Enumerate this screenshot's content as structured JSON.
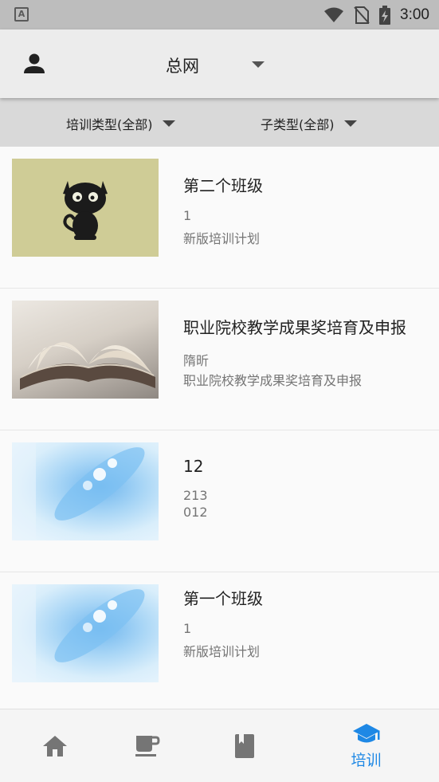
{
  "status_bar": {
    "time": "3:00",
    "notification_icon": "a-notification-icon",
    "icons": [
      "wifi-icon",
      "no-sim-icon",
      "battery-charging-icon"
    ]
  },
  "header": {
    "title": "总网",
    "user_icon": "user-icon",
    "dropdown_icon": "caret-down-icon"
  },
  "filters": [
    {
      "label": "培训类型(全部)"
    },
    {
      "label": "子类型(全部)"
    }
  ],
  "list": {
    "items": [
      {
        "title": "第二个班级",
        "line1": "1",
        "line2": "新版培训计划",
        "thumbnail": "cat-image"
      },
      {
        "title": "职业院校教学成果奖培育及申报",
        "line1": "隋昕",
        "line2": "职业院校教学成果奖培育及申报",
        "thumbnail": "book-image"
      },
      {
        "title": "12",
        "line1": "213",
        "line2": "012",
        "thumbnail": "blue-abstract-image"
      },
      {
        "title": "第一个班级",
        "line1": "1",
        "line2": "新版培训计划",
        "thumbnail": "blue-abstract-image"
      }
    ]
  },
  "bottom_nav": {
    "items": [
      {
        "icon": "home-icon",
        "label": ""
      },
      {
        "icon": "coffee-cup-icon",
        "label": ""
      },
      {
        "icon": "book-icon",
        "label": ""
      },
      {
        "icon": "graduation-cap-icon",
        "label": "培训",
        "active": true
      }
    ]
  },
  "colors": {
    "accent": "#1e88e5",
    "inactive_icon": "#757575",
    "header_bg": "#ececec",
    "filter_bg": "#d9d9d9"
  }
}
